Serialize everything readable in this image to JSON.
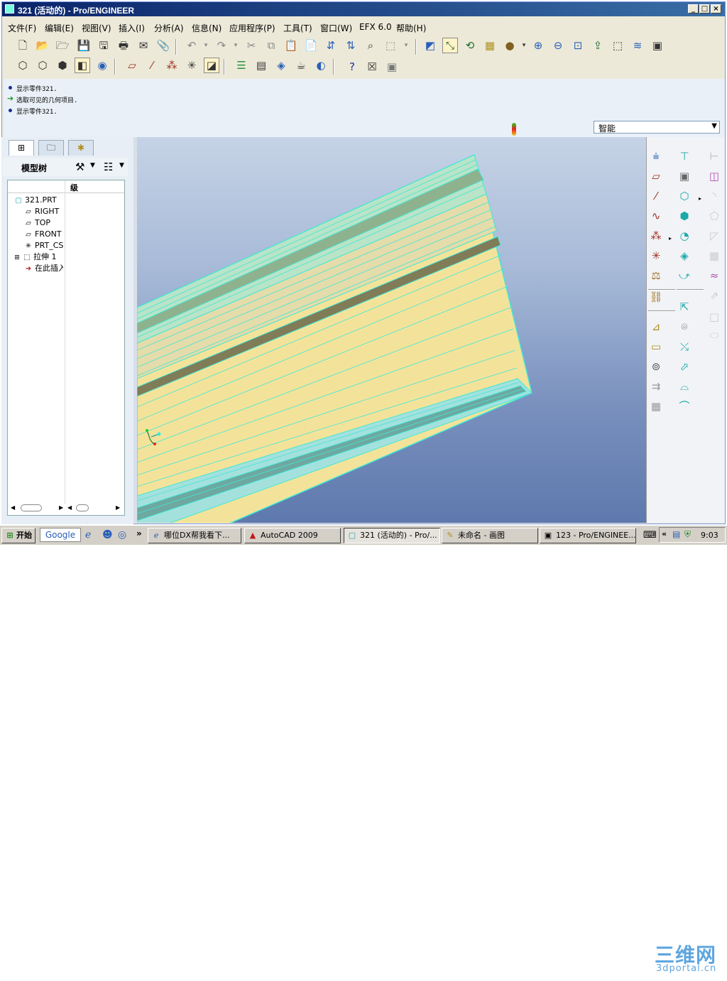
{
  "window": {
    "title": "321 (活动的) - Pro/ENGINEER",
    "controls": [
      "_",
      "□",
      "×"
    ]
  },
  "menu": [
    "文件(F)",
    "编辑(E)",
    "视图(V)",
    "插入(I)",
    "分析(A)",
    "信息(N)",
    "应用程序(P)",
    "工具(T)",
    "窗口(W)",
    "EFX 6.0",
    "帮助(H)"
  ],
  "messages": [
    "显示零件321.",
    "选取可见的几何项目.",
    "显示零件321."
  ],
  "filter": {
    "selected": "智能"
  },
  "model_tree": {
    "title": "模型树",
    "column_header": "级",
    "items": [
      "321.PRT",
      "RIGHT",
      "TOP",
      "FRONT",
      "PRT_CSYS",
      "拉伸 1",
      "在此插入"
    ]
  },
  "taskbar": {
    "start": "开始",
    "google": "Google",
    "overflow": "»",
    "tasks": [
      "哪位DX帮我看下...",
      "AutoCAD 2009",
      "321 (活动的) - Pro/...",
      "未命名 - 画图",
      "123 - Pro/ENGINEE..."
    ],
    "clock": "9:03",
    "tray_chevron": "«"
  },
  "watermark": {
    "line1": "三维网",
    "line2": "3dportal.cn"
  },
  "colors": {
    "titlebar": "#0a246a",
    "model_face": "#f3e39a",
    "model_edge": "#3ee8d8",
    "viewport_top": "#c6d3e6",
    "viewport_bottom": "#5e79ad"
  }
}
